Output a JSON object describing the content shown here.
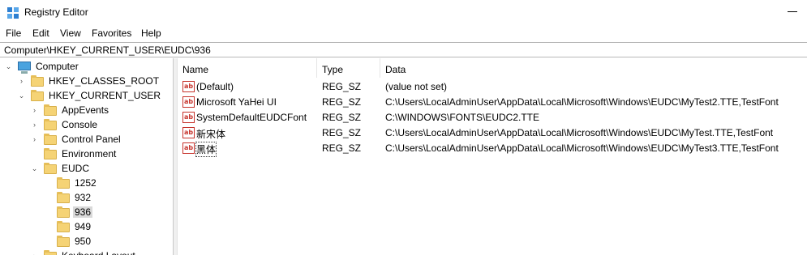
{
  "window": {
    "title": "Registry Editor"
  },
  "menu": [
    "File",
    "Edit",
    "View",
    "Favorites",
    "Help"
  ],
  "address": "Computer\\HKEY_CURRENT_USER\\EUDC\\936",
  "tree": [
    {
      "label": "Computer",
      "expander": "⌄",
      "icon": "computer-icon"
    },
    {
      "label": "HKEY_CLASSES_ROOT",
      "expander": "›",
      "icon": "folder-icon"
    },
    {
      "label": "HKEY_CURRENT_USER",
      "expander": "⌄",
      "icon": "folder-icon"
    },
    {
      "label": "AppEvents",
      "expander": "›",
      "icon": "folder-icon"
    },
    {
      "label": "Console",
      "expander": "›",
      "icon": "folder-icon"
    },
    {
      "label": "Control Panel",
      "expander": "›",
      "icon": "folder-icon"
    },
    {
      "label": "Environment",
      "expander": "",
      "icon": "folder-icon"
    },
    {
      "label": "EUDC",
      "expander": "⌄",
      "icon": "folder-icon"
    },
    {
      "label": "1252",
      "expander": "",
      "icon": "folder-icon"
    },
    {
      "label": "932",
      "expander": "",
      "icon": "folder-icon"
    },
    {
      "label": "936",
      "expander": "",
      "icon": "folder-icon",
      "selected": true
    },
    {
      "label": "949",
      "expander": "",
      "icon": "folder-icon"
    },
    {
      "label": "950",
      "expander": "",
      "icon": "folder-icon"
    },
    {
      "label": "Keyboard Layout",
      "expander": "›",
      "icon": "folder-icon"
    }
  ],
  "columns": [
    "Name",
    "Type",
    "Data"
  ],
  "values": [
    {
      "name": "(Default)",
      "type": "REG_SZ",
      "data": "(value not set)"
    },
    {
      "name": "Microsoft YaHei UI",
      "type": "REG_SZ",
      "data": "C:\\Users\\LocalAdminUser\\AppData\\Local\\Microsoft\\Windows\\EUDC\\MyTest2.TTE,TestFont"
    },
    {
      "name": "SystemDefaultEUDCFont",
      "type": "REG_SZ",
      "data": "C:\\WINDOWS\\FONTS\\EUDC2.TTE"
    },
    {
      "name": "新宋体",
      "type": "REG_SZ",
      "data": "C:\\Users\\LocalAdminUser\\AppData\\Local\\Microsoft\\Windows\\EUDC\\MyTest.TTE,TestFont"
    },
    {
      "name": "黑体",
      "type": "REG_SZ",
      "data": "C:\\Users\\LocalAdminUser\\AppData\\Local\\Microsoft\\Windows\\EUDC\\MyTest3.TTE,TestFont"
    }
  ],
  "value_icon_text": "ab"
}
